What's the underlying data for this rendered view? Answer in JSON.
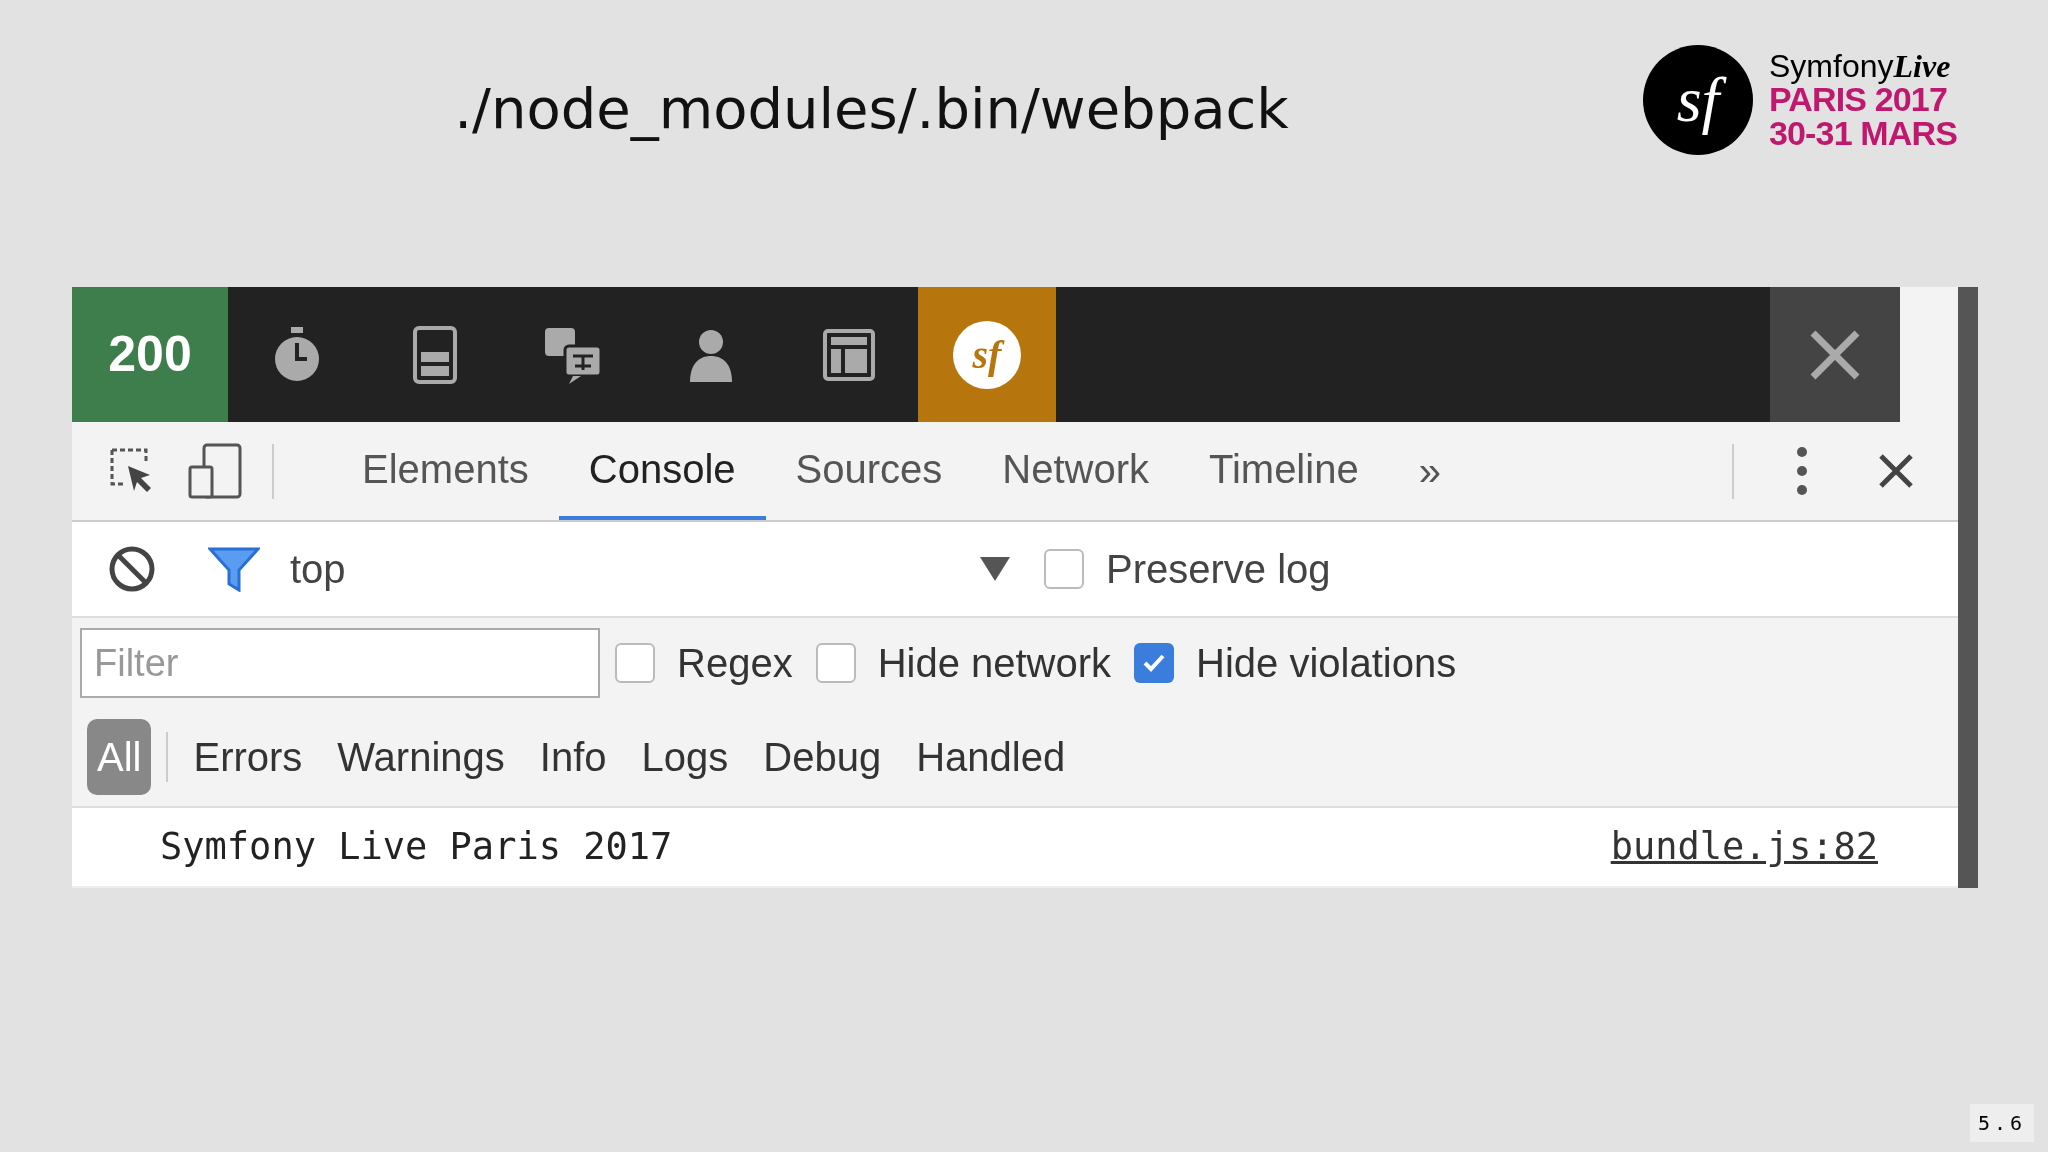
{
  "slide": {
    "title": "./node_modules/.bin/webpack",
    "page_number": "5.6"
  },
  "logo": {
    "mark": "sf",
    "name": "Symfony",
    "name_accent": "Live",
    "lines": [
      "PARIS 2017",
      "30-31 MARS"
    ]
  },
  "debug_toolbar": {
    "status": "200",
    "items": [
      {
        "kind": "timer",
        "selected": false
      },
      {
        "kind": "database",
        "selected": false
      },
      {
        "kind": "translation",
        "selected": false
      },
      {
        "kind": "user",
        "selected": false
      },
      {
        "kind": "layout",
        "selected": false
      },
      {
        "kind": "symfony",
        "label": "sf",
        "selected": true
      }
    ]
  },
  "devtools": {
    "tabs": [
      {
        "label": "Elements",
        "selected": false
      },
      {
        "label": "Console",
        "selected": true
      },
      {
        "label": "Sources",
        "selected": false
      },
      {
        "label": "Network",
        "selected": false
      },
      {
        "label": "Timeline",
        "selected": false
      }
    ],
    "more": "»",
    "context": "top",
    "preserve_log": {
      "label": "Preserve log",
      "checked": false
    },
    "filter": {
      "placeholder": "Filter"
    },
    "options": [
      {
        "label": "Regex",
        "checked": false
      },
      {
        "label": "Hide network",
        "checked": false
      },
      {
        "label": "Hide violations",
        "checked": true
      }
    ],
    "levels": [
      {
        "label": "All",
        "selected": true
      },
      {
        "label": "Errors",
        "selected": false
      },
      {
        "label": "Warnings",
        "selected": false
      },
      {
        "label": "Info",
        "selected": false
      },
      {
        "label": "Logs",
        "selected": false
      },
      {
        "label": "Debug",
        "selected": false
      },
      {
        "label": "Handled",
        "selected": false
      }
    ],
    "messages": [
      {
        "text": "Symfony Live Paris 2017",
        "source": "bundle.js:82"
      }
    ]
  }
}
